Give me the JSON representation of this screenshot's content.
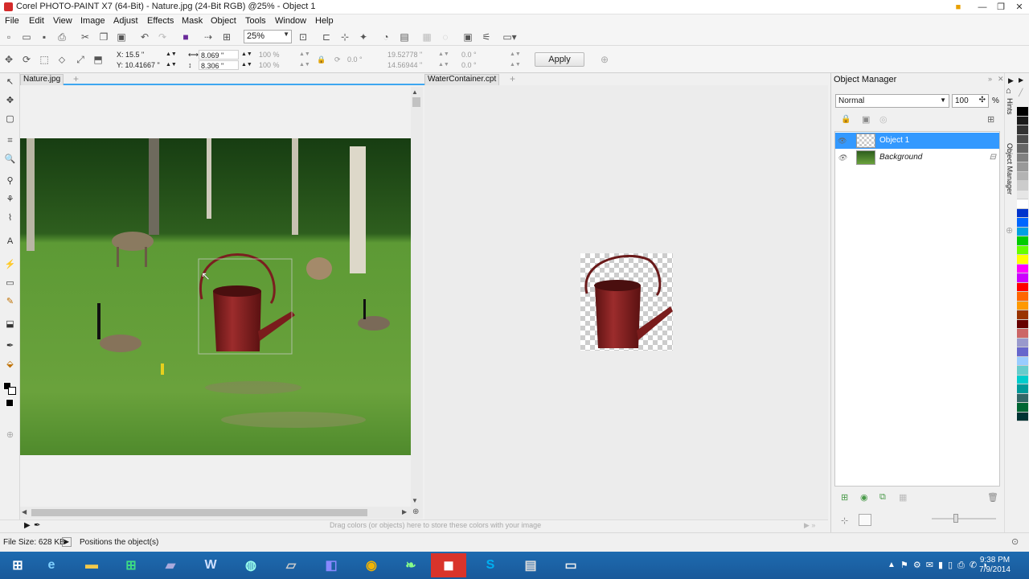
{
  "window": {
    "title": "Corel PHOTO-PAINT X7 (64-Bit) - Nature.jpg (24-Bit RGB) @25% - Object 1"
  },
  "menu": [
    "File",
    "Edit",
    "View",
    "Image",
    "Adjust",
    "Effects",
    "Mask",
    "Object",
    "Tools",
    "Window",
    "Help"
  ],
  "toolbar": {
    "zoom": "25%"
  },
  "propbar": {
    "x": "X: 15.5 \"",
    "y": "Y: 10.41667 \"",
    "w": "8.069 \"",
    "h": "8.306 \"",
    "sw": "100 %",
    "sh": "100 %",
    "angle": "0.0 °",
    "cx": "19.52778 \"",
    "cy": "14.56944 \"",
    "skx": "0.0 °",
    "sky": "0.0 °",
    "apply": "Apply"
  },
  "documents": [
    {
      "tab": "Nature.jpg"
    },
    {
      "tab": "WaterContainer.cpt"
    }
  ],
  "object_manager": {
    "title": "Object Manager",
    "blend": "Normal",
    "opacity": "100",
    "opacity_unit": "%",
    "layers": [
      {
        "name": "Object 1",
        "selected": true
      },
      {
        "name": "Background",
        "selected": false
      }
    ],
    "dock_tabs": [
      "Hints",
      "Object Manager"
    ]
  },
  "colorbar": {
    "hint": "Drag colors (or objects) here to store these colors with your image"
  },
  "status": {
    "file_size": "File Size: 628 KB",
    "message": "Positions the object(s)"
  },
  "taskbar": {
    "time": "9:38 PM",
    "date": "7/9/2014"
  },
  "palette": [
    "#000000",
    "#1a1a1a",
    "#333333",
    "#4d4d4d",
    "#666666",
    "#808080",
    "#999999",
    "#b3b3b3",
    "#cccccc",
    "#e6e6e6",
    "#ffffff",
    "#0033cc",
    "#0066ff",
    "#00a0e0",
    "#00cc00",
    "#66ff00",
    "#ffff00",
    "#ff00ff",
    "#cc00ff",
    "#ff0000",
    "#ff6600",
    "#ff9900",
    "#993300",
    "#660000",
    "#cc6666",
    "#9999cc",
    "#6666cc",
    "#99ccff",
    "#66cccc",
    "#00cccc",
    "#009999",
    "#336666",
    "#006633",
    "#003333"
  ]
}
